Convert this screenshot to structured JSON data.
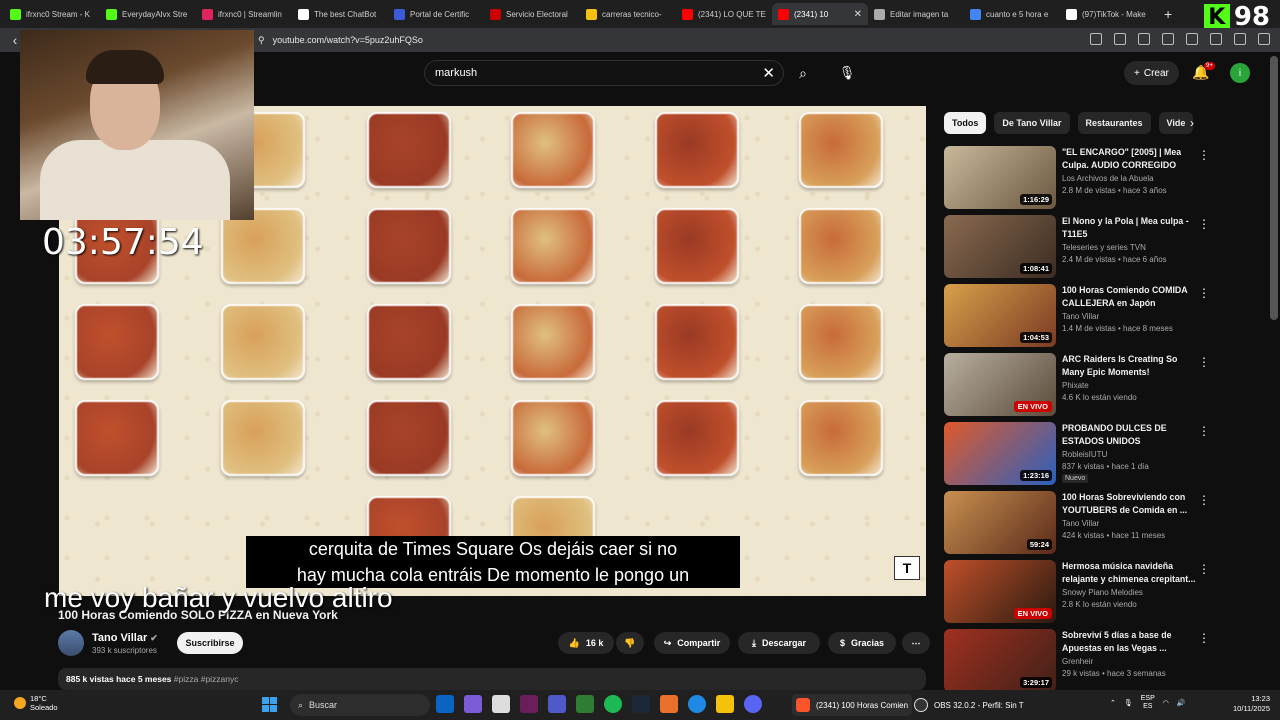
{
  "browser": {
    "tabs": [
      {
        "label": "ifrxnc0 Stream - K",
        "color": "#53fc18"
      },
      {
        "label": "EverydayAlvx Stre",
        "color": "#53fc18"
      },
      {
        "label": "ifrxnc0 | Streamlin",
        "color": "#e0245e"
      },
      {
        "label": "The best ChatBot",
        "color": "#ffffff"
      },
      {
        "label": "Portal de Certific",
        "color": "#3b5bdb"
      },
      {
        "label": "Servicio Electoral",
        "color": "#cc0000"
      },
      {
        "label": "carreras tecnico-",
        "color": "#f4c20d"
      },
      {
        "label": "(2341) LO QUE TE",
        "color": "#ff0000"
      },
      {
        "label": "(2341) 10",
        "color": "#ff0000",
        "active": true
      },
      {
        "label": "Editar imagen ta",
        "color": "#aaaaaa"
      },
      {
        "label": "cuanto e 5 hora e",
        "color": "#4285f4"
      },
      {
        "label": "(97)TikTok - Make",
        "color": "#ffffff"
      }
    ],
    "new_tab": "+",
    "url": "youtube.com/watch?v=5puz2uhFQSo"
  },
  "kick_overlay": {
    "logo": "K",
    "count": "98"
  },
  "youtube": {
    "search_value": "markush",
    "create_label": "Crear",
    "notif_badge": "9+",
    "avatar_letter": "i",
    "video": {
      "title": "100 Horas Comiendo SOLO PIZZA en Nueva York",
      "channel": "Tano Villar",
      "subscribers": "393 k suscriptores",
      "subscribe_label": "Suscribirse",
      "likes": "16 k",
      "share_label": "Compartir",
      "download_label": "Descargar",
      "thanks_label": "Gracias",
      "views": "885 k vistas",
      "age": "hace 5 meses",
      "tags": "#pizza #pizzanyc",
      "caption_line1": "cerquita de Times Square Os dejáis caer si no",
      "caption_line2": "hay mucha cola entráis De momento le pongo un",
      "brand_mark": "T"
    },
    "chips": [
      "Todos",
      "De Tano Villar",
      "Restaurantes",
      "Vide"
    ],
    "recommendations": [
      {
        "title": "\"EL ENCARGO\" [2005] | Mea Culpa. AUDIO CORREGIDO",
        "channel": "Los Archivos de la Abuela",
        "meta": "2.8 M de vistas • hace 3 años",
        "duration": "1:16:29",
        "live": false,
        "new": "",
        "colors": [
          "#c9b89a",
          "#6b5840"
        ]
      },
      {
        "title": "El Nono y la Pola | Mea culpa - T11E5",
        "channel": "Teleseries y series TVN",
        "meta": "2.4 M de vistas • hace 6 años",
        "duration": "1:08:41",
        "live": false,
        "new": "",
        "colors": [
          "#8a6a50",
          "#3b2c22"
        ]
      },
      {
        "title": "100 Horas Comiendo COMIDA CALLEJERA en Japón",
        "channel": "Tano Villar",
        "meta": "1.4 M de vistas • hace 8 meses",
        "duration": "1:04:53",
        "live": false,
        "new": "",
        "colors": [
          "#d8a04a",
          "#7a3a22"
        ]
      },
      {
        "title": "ARC Raiders Is Creating So Many Epic Moments!",
        "channel": "Phixate",
        "meta": "4.6 K lo están viendo",
        "duration": "EN VIVO",
        "live": true,
        "new": "",
        "colors": [
          "#b9b0a0",
          "#5a4a3a"
        ]
      },
      {
        "title": "PROBANDO DULCES DE ESTADOS UNIDOS",
        "channel": "RobleisIUTU",
        "meta": "837 k vistas • hace 1 día",
        "duration": "1:23:16",
        "live": false,
        "new": "Nuevo",
        "colors": [
          "#e05a2a",
          "#2a60c0"
        ]
      },
      {
        "title": "100 Horas Sobreviviendo con YOUTUBERS de Comida en ...",
        "channel": "Tano Villar",
        "meta": "424 k vistas • hace 11 meses",
        "duration": "59:24",
        "live": false,
        "new": "",
        "colors": [
          "#c89050",
          "#5a2a1a"
        ]
      },
      {
        "title": "Hermosa música navideña relajante y chimenea crepitant...",
        "channel": "Snowy Piano Melodies",
        "meta": "2.8 K lo están viendo",
        "duration": "EN VIVO",
        "live": true,
        "new": "",
        "colors": [
          "#c0502a",
          "#2a1a10"
        ]
      },
      {
        "title": "Sobreviví 5 días a base de Apuestas en las Vegas ...",
        "channel": "Grenheir",
        "meta": "29 k vistas • hace 3 semanas",
        "duration": "3:29:17",
        "live": false,
        "new": "",
        "colors": [
          "#a03020",
          "#402018"
        ]
      }
    ]
  },
  "overlay": {
    "timer": "03:57:54",
    "text": "me voy bañar y vuelvo altiro"
  },
  "taskbar": {
    "temperature": "18°C",
    "condition": "Soleado",
    "search_label": "Buscar",
    "task1": "(2341) 100 Horas Comien",
    "task2": "OBS 32.0.2 - Perfil: Sin T",
    "lang1": "ESP",
    "lang2": "ES",
    "time": "13:23",
    "date": "10/11/2025"
  }
}
